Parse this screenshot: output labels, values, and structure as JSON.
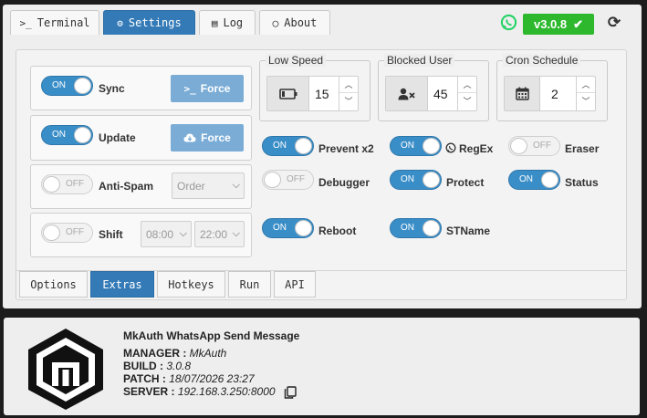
{
  "tabs": [
    {
      "label": "Terminal",
      "icon": "terminal-icon"
    },
    {
      "label": "Settings",
      "icon": "gear-icon"
    },
    {
      "label": "Log",
      "icon": "list-icon"
    },
    {
      "label": "About",
      "icon": "speech-bubble-icon"
    }
  ],
  "version_badge": "v3.0.8",
  "switch_text": {
    "on": "ON",
    "off": "OFF"
  },
  "left_rows": {
    "sync": {
      "label": "Sync",
      "state": "ON",
      "button": "Force",
      "button_icon": "terminal-icon"
    },
    "update": {
      "label": "Update",
      "state": "ON",
      "button": "Force",
      "button_icon": "cloud-download-icon"
    },
    "antispam": {
      "label": "Anti-Spam",
      "state": "OFF",
      "select_value": "Order"
    },
    "shift": {
      "label": "Shift",
      "state": "OFF",
      "start": "08:00",
      "end": "22:00"
    }
  },
  "fieldsets": {
    "low_speed": {
      "legend": "Low Speed",
      "value": "15",
      "icon": "battery-low-icon"
    },
    "blocked_user": {
      "legend": "Blocked User",
      "value": "45",
      "icon": "user-x-icon"
    },
    "cron_schedule": {
      "legend": "Cron Schedule",
      "value": "2",
      "icon": "calendar-icon"
    }
  },
  "options": [
    {
      "label": "Prevent x2",
      "state": "ON"
    },
    {
      "label": "RegEx",
      "state": "ON",
      "icon": "whatsapp-icon"
    },
    {
      "label": "Eraser",
      "state": "OFF"
    },
    {
      "label": "Debugger",
      "state": "OFF"
    },
    {
      "label": "Protect",
      "state": "ON"
    },
    {
      "label": "Status",
      "state": "ON"
    },
    {
      "label": "Reboot",
      "state": "ON"
    },
    {
      "label": "STName",
      "state": "ON"
    }
  ],
  "bottom_tabs": [
    "Options",
    "Extras",
    "Hotkeys",
    "Run",
    "API"
  ],
  "footer": {
    "title": "MkAuth WhatsApp Send Message",
    "manager_label": "MANAGER :",
    "manager": "MkAuth",
    "build_label": "BUILD :",
    "build": "3.0.8",
    "patch_label": "PATCH :",
    "patch": "18/07/2026 23:27",
    "server_label": "SERVER :",
    "server": "192.168.3.250:8000"
  },
  "colors": {
    "primary": "#337ab7",
    "success": "#2eb82e",
    "toggle_on": "#3a8ec8",
    "force_button": "#7aacd6"
  }
}
